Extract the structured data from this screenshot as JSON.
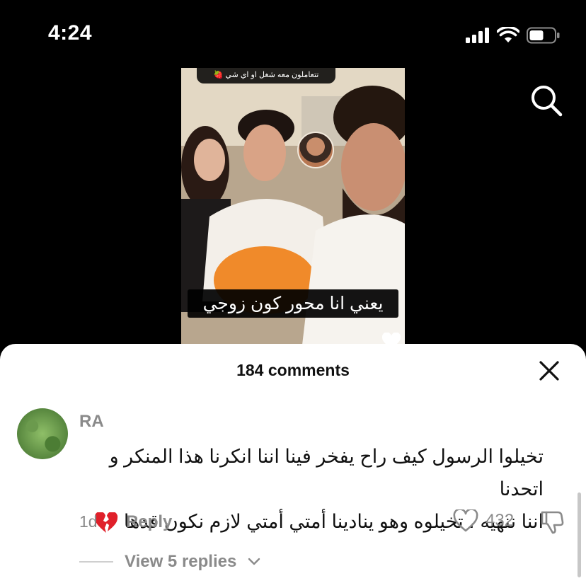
{
  "status_bar": {
    "time": "4:24"
  },
  "video": {
    "top_caption": "تتعاملون معه شغل او اي شي 🍓",
    "subtitle": "يعني انا محور كون زوجي"
  },
  "comments_sheet": {
    "title": "184 comments",
    "comment": {
      "username": "RA",
      "text_line1": "تخيلوا الرسول كيف راح يفخر فينا اننا انكرنا هذا المنكر و اتحدنا",
      "text_line2": "اننا ننهيه ، تخيلوه وهو ينادينا أمتي أمتي لازم نكون قدها",
      "time": "1d",
      "reply_label": "Reply",
      "like_count": "432",
      "view_replies": "View 5 replies"
    }
  },
  "icons": {
    "search": "search-icon",
    "close": "close-icon",
    "like": "heart-outline-icon",
    "dislike": "thumbs-down-icon",
    "broken_heart": "broken-heart-emoji"
  },
  "colors": {
    "sheet_bg": "#ffffff",
    "muted_text": "#8a8a8a",
    "background": "#000000"
  }
}
